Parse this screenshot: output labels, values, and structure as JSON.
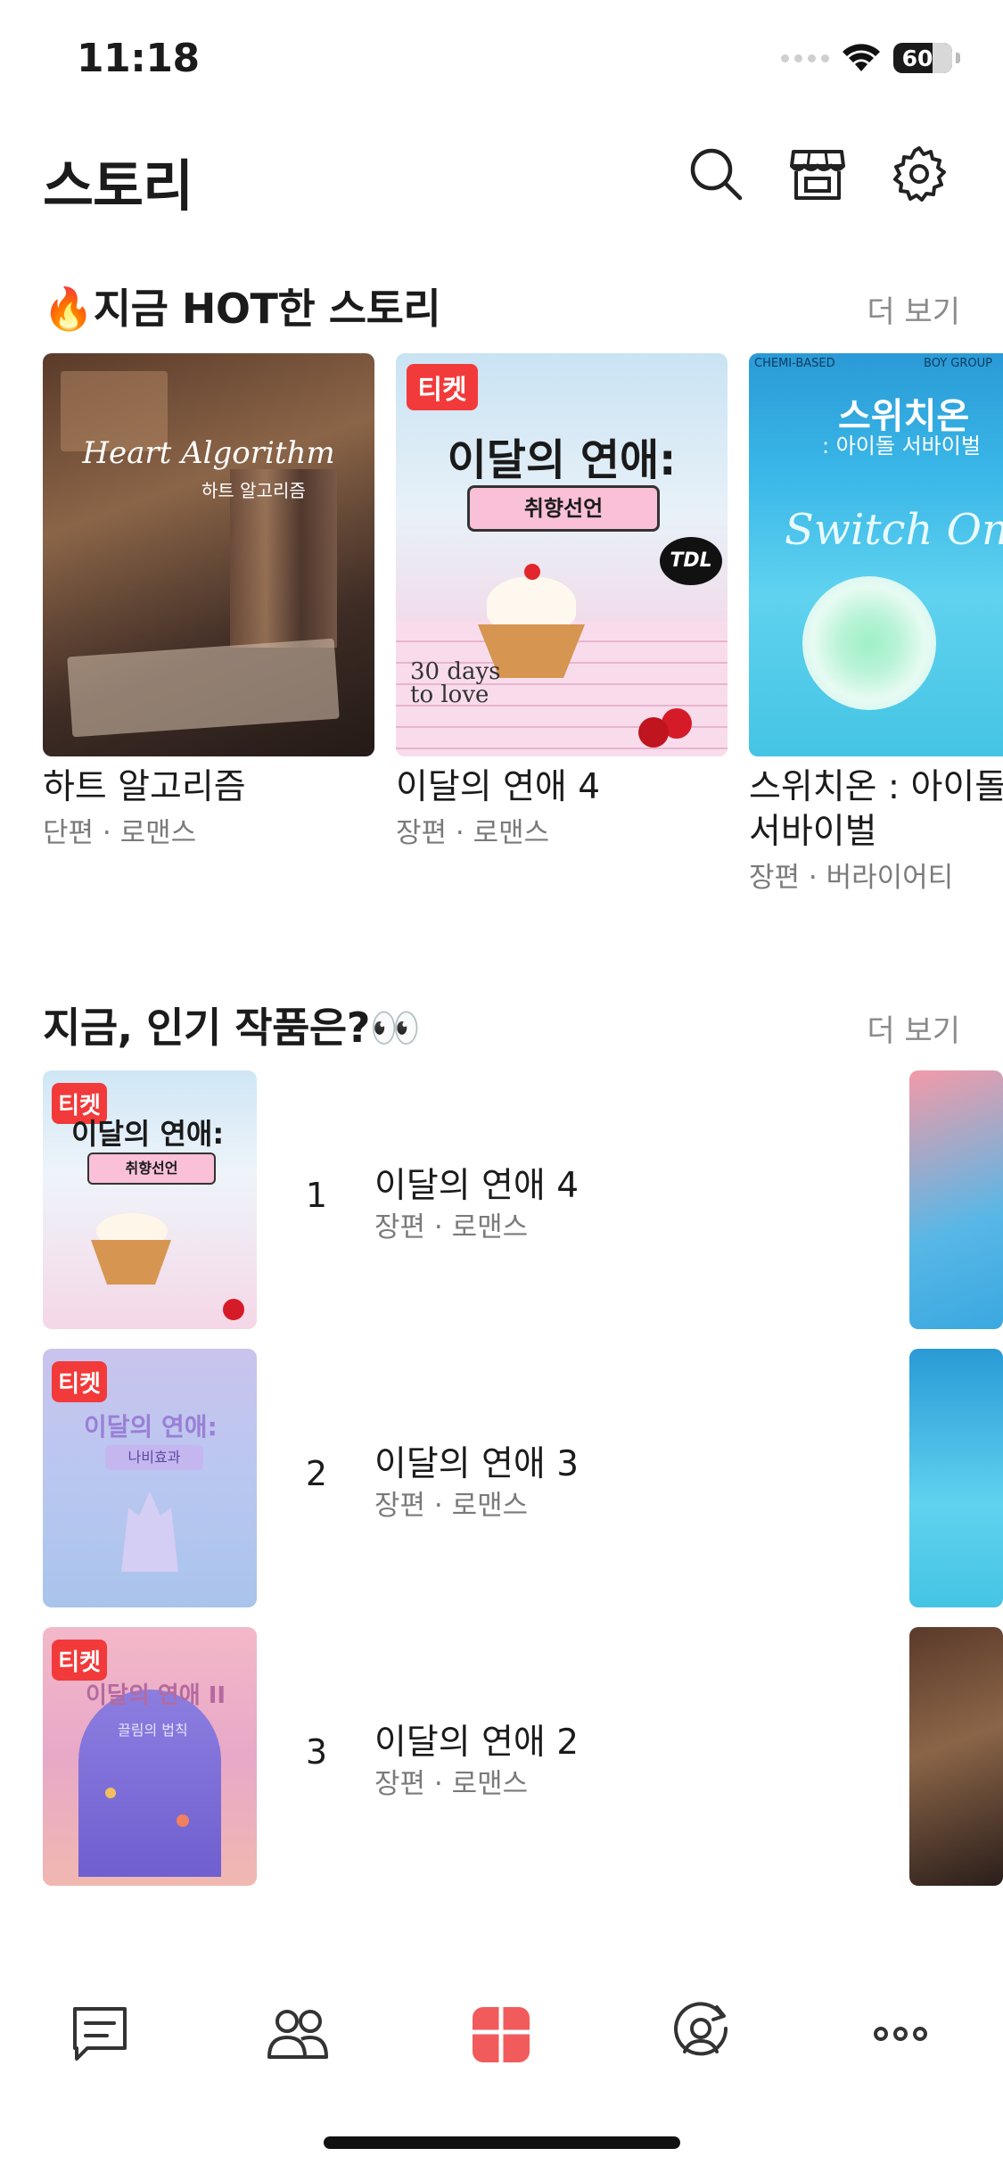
{
  "status": {
    "time": "11:18",
    "battery": "60"
  },
  "header": {
    "title": "스토리",
    "icons": [
      "search-icon",
      "store-icon",
      "settings-icon"
    ]
  },
  "hot": {
    "title": "🔥지금 HOT한 스토리",
    "more": "더 보기",
    "items": [
      {
        "title": "하트 알고리즘",
        "meta": "단편 · 로맨스",
        "cover_title": "Heart Algorithm",
        "cover_subtitle": "하트 알고리즘"
      },
      {
        "title": "이달의 연애 4",
        "meta": "장편 · 로맨스",
        "badge": "티켓",
        "cover_title": "이달의 연애:",
        "cover_subtitle": "취향선언",
        "cover_tag": "TDL",
        "cover_days": "30 days to love"
      },
      {
        "title_line1": "스위치온 : 아이돌",
        "title_line2": "서바이벌",
        "meta": "장편 · 버라이어티",
        "cover_top_left": "CHEMI-BASED",
        "cover_top_right": "BOY GROUP",
        "cover_title": "스위치온",
        "cover_subtitle": ": 아이돌 서바이벌",
        "cover_script": "Switch On"
      }
    ]
  },
  "popular": {
    "title": "지금, 인기 작품은?👀",
    "more": "더 보기",
    "items": [
      {
        "rank": "1",
        "title": "이달의 연애 4",
        "meta": "장편 · 로맨스",
        "badge": "티켓",
        "cover_title": "이달의 연애:",
        "cover_subtitle": "취향선언"
      },
      {
        "rank": "2",
        "title": "이달의 연애 3",
        "meta": "장편 · 로맨스",
        "badge": "티켓",
        "cover_title": "이달의 연애:",
        "cover_subtitle": "나비효과"
      },
      {
        "rank": "3",
        "title": "이달의 연애 2",
        "meta": "장편 · 로맨스",
        "badge": "티켓",
        "cover_title": "이달의 연애 II",
        "cover_subtitle": "끌림의 법칙"
      }
    ]
  },
  "tabbar": {
    "items": [
      "chat-tab",
      "friends-tab",
      "story-tab",
      "profile-tab",
      "more-tab"
    ],
    "active": "story-tab",
    "active_color": "#f25b5b"
  },
  "colors": {
    "accent": "#f25b5b",
    "ticket": "#f23a3a"
  }
}
